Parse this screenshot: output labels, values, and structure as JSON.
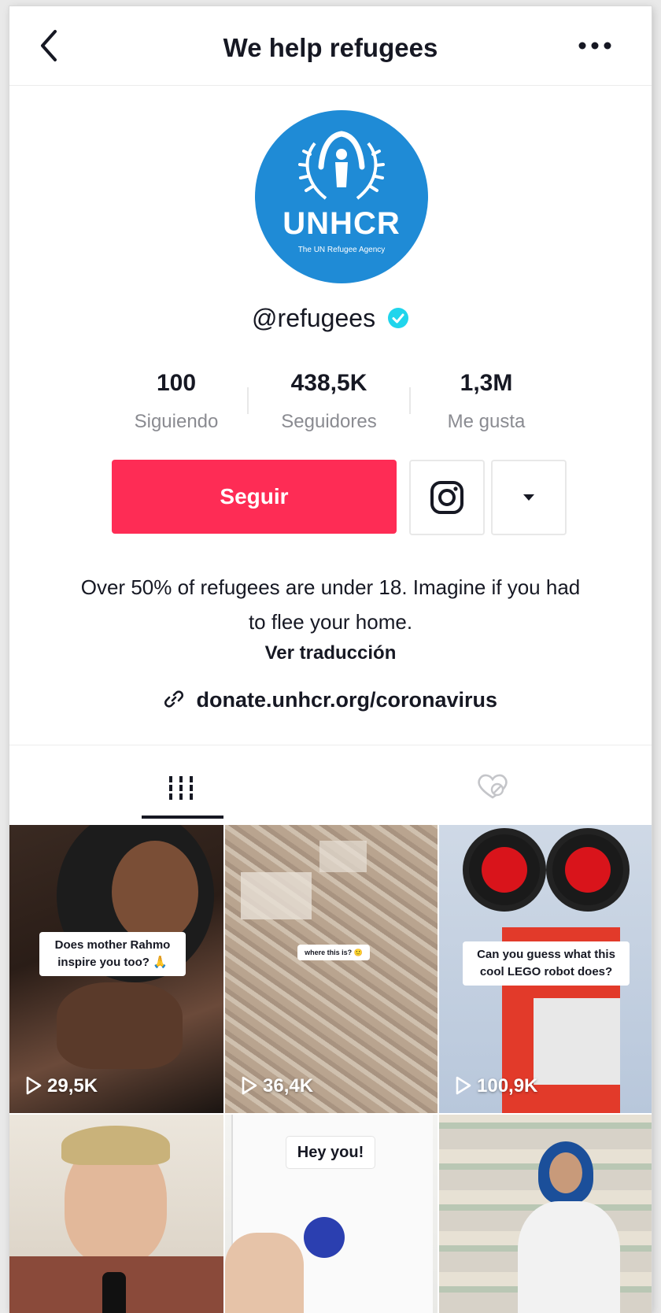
{
  "header": {
    "title": "We help refugees",
    "back_icon": "chevron-left-icon",
    "more_icon": "more-horizontal-icon"
  },
  "profile": {
    "avatar_text": "UNHCR",
    "avatar_subtext": "The UN Refugee Agency",
    "username": "@refugees",
    "verified": true,
    "accent_color": "#fe2c55",
    "verified_color": "#20d5ec"
  },
  "stats": [
    {
      "value": "100",
      "label": "Siguiendo"
    },
    {
      "value": "438,5K",
      "label": "Seguidores"
    },
    {
      "value": "1,3M",
      "label": "Me gusta"
    }
  ],
  "actions": {
    "follow_label": "Seguir",
    "instagram_icon": "instagram-icon",
    "dropdown_icon": "caret-down-icon"
  },
  "bio": {
    "text": "Over 50% of refugees are under 18. Imagine if you had to flee your home.",
    "translate_label": "Ver traducción",
    "link": "donate.unhcr.org/coronavirus"
  },
  "tabs": [
    {
      "name": "videos",
      "icon": "grid-icon",
      "active": true
    },
    {
      "name": "liked",
      "icon": "liked-hidden-icon",
      "active": false
    }
  ],
  "videos": [
    {
      "caption": "Does mother Rahmo inspire you too? 🙏",
      "plays": "29,5K"
    },
    {
      "caption": "where this is? 🙂",
      "plays": "36,4K"
    },
    {
      "caption": "Can you guess what this cool LEGO robot does?",
      "plays": "100,9K"
    },
    {
      "caption": "",
      "plays": ""
    },
    {
      "caption": "Hey you!",
      "plays": ""
    },
    {
      "caption": "",
      "plays": ""
    }
  ]
}
